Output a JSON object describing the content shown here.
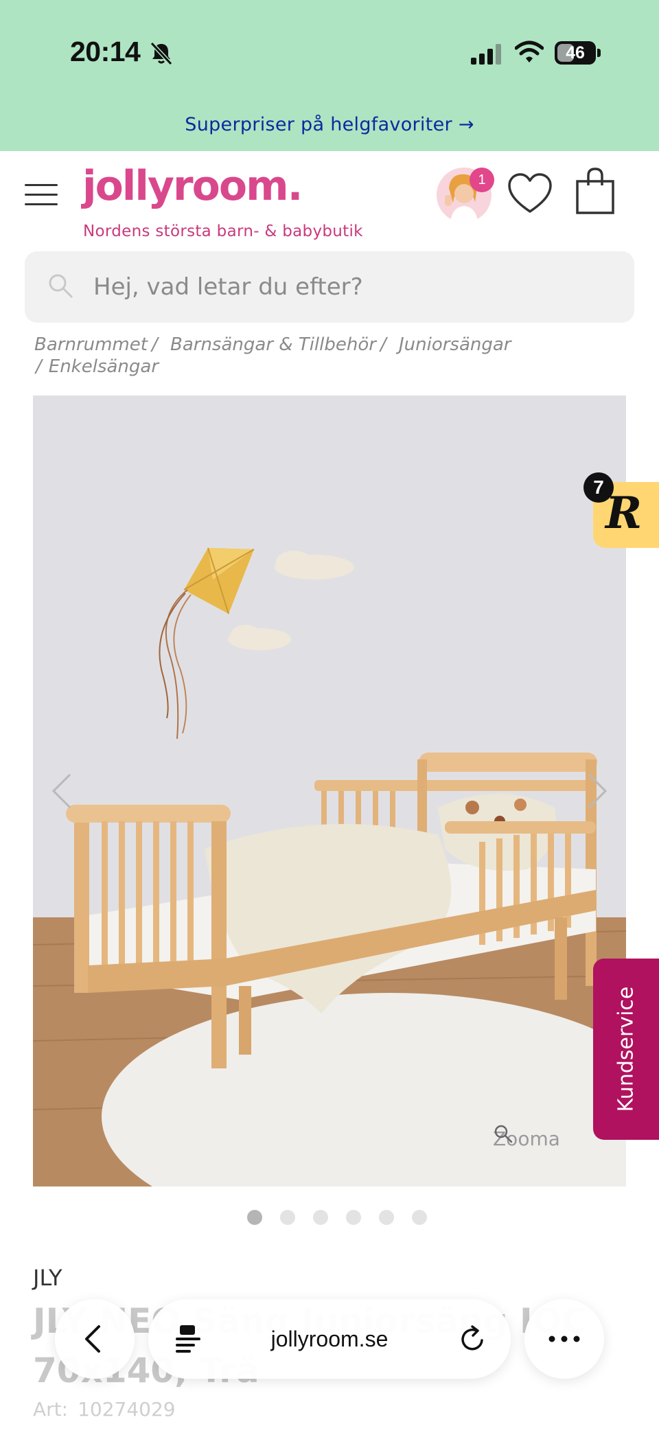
{
  "status_bar": {
    "time": "20:14",
    "battery": "46",
    "battery_level": 0.46
  },
  "promo": {
    "text": "Superpriser på helgfavoriter →"
  },
  "header": {
    "logo": "jollyroom.",
    "tagline": "Nordens största barn- & babybutik",
    "avatar_badge": "1",
    "brand_color": "#d9488c"
  },
  "search": {
    "placeholder": "Hej, vad letar du efter?",
    "value": ""
  },
  "breadcrumb": {
    "items": [
      {
        "label": "Barnrummet"
      },
      {
        "label": "Barnsängar & Tillbehör"
      },
      {
        "label": "Juniorsängar"
      },
      {
        "label": "Enkelsängar"
      }
    ],
    "separator": "/"
  },
  "gallery": {
    "zoom_label": "Zooma",
    "image_count": 6,
    "active_index": 0
  },
  "widgets": {
    "r_badge": "7",
    "r_letter": "R",
    "kundservice": "Kundservice",
    "kundservice_color": "#b0125f"
  },
  "product": {
    "brand": "JLY",
    "title": "JLY NEO Säng Juniorsäng IOC 70x140, Trä",
    "art_label": "Art:",
    "art_number": "10274029"
  },
  "browser": {
    "url": "jollyroom.se"
  },
  "icons": {
    "menu": "hamburger-menu-icon",
    "wishlist": "heart-icon",
    "cart": "shopping-bag-icon",
    "search": "search-icon",
    "zoom": "magnifier-icon",
    "back": "chevron-left-icon",
    "reader": "reader-icon",
    "reload": "reload-icon",
    "more": "more-icon"
  }
}
